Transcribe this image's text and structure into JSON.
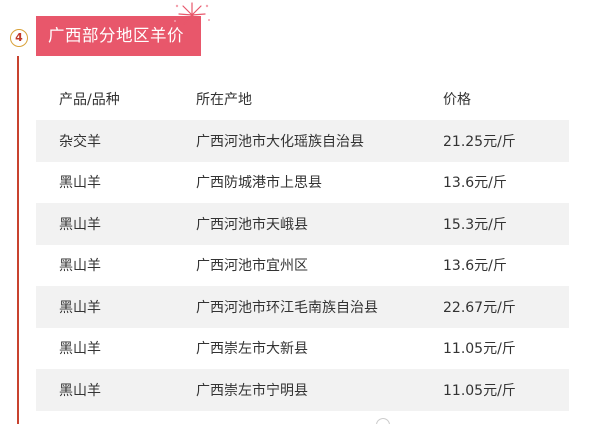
{
  "section": {
    "number": "4",
    "title": "广西部分地区羊价"
  },
  "table": {
    "headers": [
      "产品/品种",
      "所在产地",
      "价格"
    ],
    "rows": [
      {
        "product": "杂交羊",
        "origin": "广西河池市大化瑶族自治县",
        "price": "21.25元/斤"
      },
      {
        "product": "黑山羊",
        "origin": "广西防城港市上思县",
        "price": "13.6元/斤"
      },
      {
        "product": "黑山羊",
        "origin": "广西河池市天峨县",
        "price": "15.3元/斤"
      },
      {
        "product": "黑山羊",
        "origin": "广西河池市宜州区",
        "price": "13.6元/斤"
      },
      {
        "product": "黑山羊",
        "origin": "广西河池市环江毛南族自治县",
        "price": "22.67元/斤"
      },
      {
        "product": "黑山羊",
        "origin": "广西崇左市大新县",
        "price": "11.05元/斤"
      },
      {
        "product": "黑山羊",
        "origin": "广西崇左市宁明县",
        "price": "11.05元/斤"
      }
    ]
  },
  "colors": {
    "title_bg": "#e8576b",
    "timeline": "#c8432f",
    "row_shade": "#f2f2f2",
    "badge_ring": "#d9a23a"
  }
}
